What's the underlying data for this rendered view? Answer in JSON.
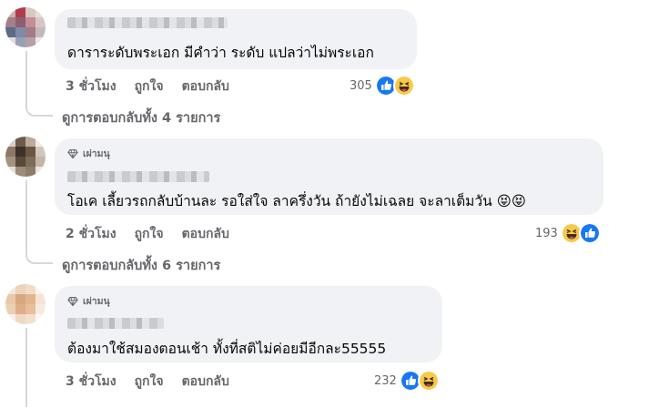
{
  "comments": [
    {
      "badge": "",
      "text": "ดาราระดับพระเอก มีคำว่า ระดับ แปลว่าไม่พระเอก",
      "time": "3 ชั่วโมง",
      "like": "ถูกใจ",
      "reply": "ตอบกลับ",
      "reaction_count": "305",
      "reactions": [
        "like-icon",
        "haha-icon"
      ],
      "view_replies": "ดูการตอบกลับทั้ง 4 รายการ"
    },
    {
      "badge": "เผ่ามนุ",
      "text": "โอเค เลี้ยวรถกลับบ้านละ รอใส่ใจ ลาครึ่งวัน ถ้ายังไม่เฉลย จะลาเต็มวัน 😝😝",
      "time": "2 ชั่วโมง",
      "like": "ถูกใจ",
      "reply": "ตอบกลับ",
      "reaction_count": "193",
      "reactions": [
        "haha-icon",
        "like-icon"
      ],
      "view_replies": "ดูการตอบกลับทั้ง 6 รายการ"
    },
    {
      "badge": "เผ่ามนุ",
      "text": "ต้องมาใช้สมองตอนเช้า ทั้งที่สติไม่ค่อยมีอีกละ55555",
      "time": "3 ชั่วโมง",
      "like": "ถูกใจ",
      "reply": "ตอบกลับ",
      "reaction_count": "232",
      "reactions": [
        "like-icon",
        "haha-icon"
      ]
    }
  ],
  "colors": {
    "bubble": "#f0f2f5",
    "meta_text": "#65676b",
    "like_blue": "#1877f2",
    "haha_yellow": "#f7c948"
  }
}
